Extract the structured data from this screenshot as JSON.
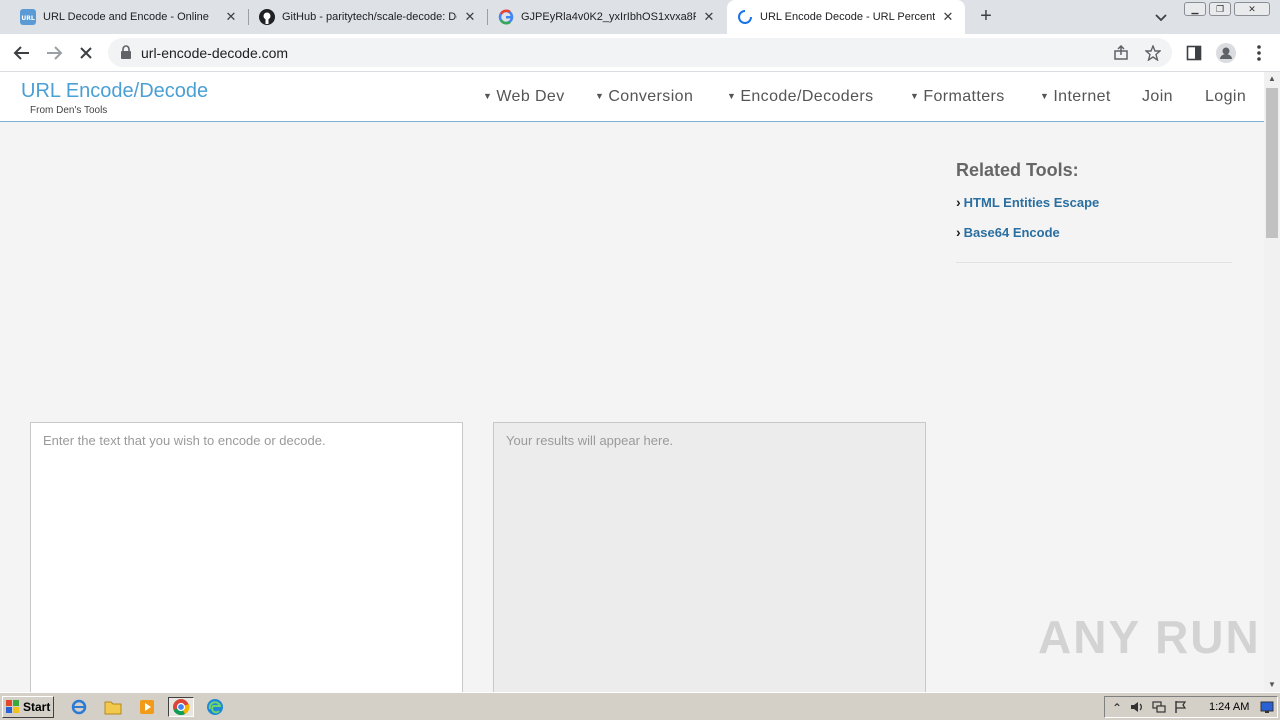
{
  "browser": {
    "tabs": [
      {
        "title": "URL Decode and Encode - Online",
        "favicon": "url-favicon-icon",
        "active": false
      },
      {
        "title": "GitHub - paritytech/scale-decode: De",
        "favicon": "github-icon",
        "active": false
      },
      {
        "title": "GJPEyRla4v0K2_yxIrIbhOS1xvxa8F",
        "favicon": "google-icon",
        "active": false
      },
      {
        "title": "URL Encode Decode - URL Percent E",
        "favicon": "loading-spinner-icon",
        "active": true
      }
    ],
    "address": "url-encode-decode.com"
  },
  "site": {
    "brand": "URL Encode/Decode",
    "brand_sub": "From Den's Tools",
    "nav": [
      {
        "label": "Web Dev",
        "dropdown": true
      },
      {
        "label": "Conversion",
        "dropdown": true
      },
      {
        "label": "Encode/Decoders",
        "dropdown": true
      },
      {
        "label": "Formatters",
        "dropdown": true
      },
      {
        "label": "Internet",
        "dropdown": true
      },
      {
        "label": "Join",
        "dropdown": false
      },
      {
        "label": "Login",
        "dropdown": false
      }
    ]
  },
  "related": {
    "title": "Related Tools:",
    "links": [
      "HTML Entities Escape",
      "Base64 Encode"
    ]
  },
  "editor": {
    "input_placeholder": "Enter the text that you wish to encode or decode.",
    "output_placeholder": "Your results will appear here."
  },
  "watermark": "ANY RUN",
  "taskbar": {
    "start_label": "Start",
    "clock": "1:24 AM"
  },
  "colors": {
    "brand": "#4a9fd4",
    "link": "#2a6fa0",
    "header_border": "#7fb3d5"
  }
}
